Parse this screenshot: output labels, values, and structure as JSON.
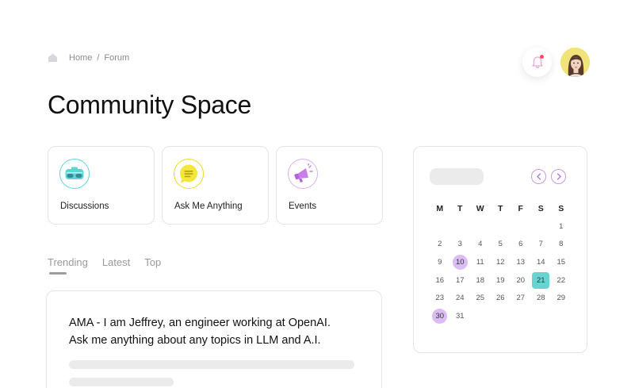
{
  "breadcrumb": {
    "home": "Home",
    "separator": "/",
    "current": "Forum"
  },
  "header": {
    "notification_icon": "bell-icon",
    "has_unread": true,
    "avatar": "user-avatar"
  },
  "page_title": "Community Space",
  "categories": [
    {
      "label": "Discussions",
      "icon": "vr-headset-icon",
      "color": "#5ed4d4"
    },
    {
      "label": "Ask Me Anything",
      "icon": "chat-bubble-icon",
      "color": "#f5e63a"
    },
    {
      "label": "Events",
      "icon": "megaphone-icon",
      "color": "#c77dea"
    }
  ],
  "tabs": [
    {
      "label": "Trending",
      "active": true
    },
    {
      "label": "Latest",
      "active": false
    },
    {
      "label": "Top",
      "active": false
    }
  ],
  "post": {
    "title_line1": "AMA - I am Jeffrey, an engineer working at OpenAI.",
    "title_line2": "Ask me anything about any topics in LLM and A.I."
  },
  "calendar": {
    "weekdays": [
      "M",
      "T",
      "W",
      "T",
      "F",
      "S",
      "S"
    ],
    "days": [
      [
        "",
        "",
        "",
        "",
        "",
        "",
        "1"
      ],
      [
        "2",
        "3",
        "4",
        "5",
        "6",
        "7",
        "8"
      ],
      [
        "9",
        "10",
        "11",
        "12",
        "13",
        "14",
        "15"
      ],
      [
        "16",
        "17",
        "18",
        "19",
        "20",
        "21",
        "22"
      ],
      [
        "23",
        "24",
        "25",
        "26",
        "27",
        "28",
        "29"
      ],
      [
        "30",
        "31",
        "",
        "",
        "",
        "",
        ""
      ]
    ],
    "highlighted_days": [
      "10",
      "30"
    ],
    "selected_day": "21",
    "highlight_color": "#dcbdf3",
    "selected_color": "#69d3d1"
  }
}
